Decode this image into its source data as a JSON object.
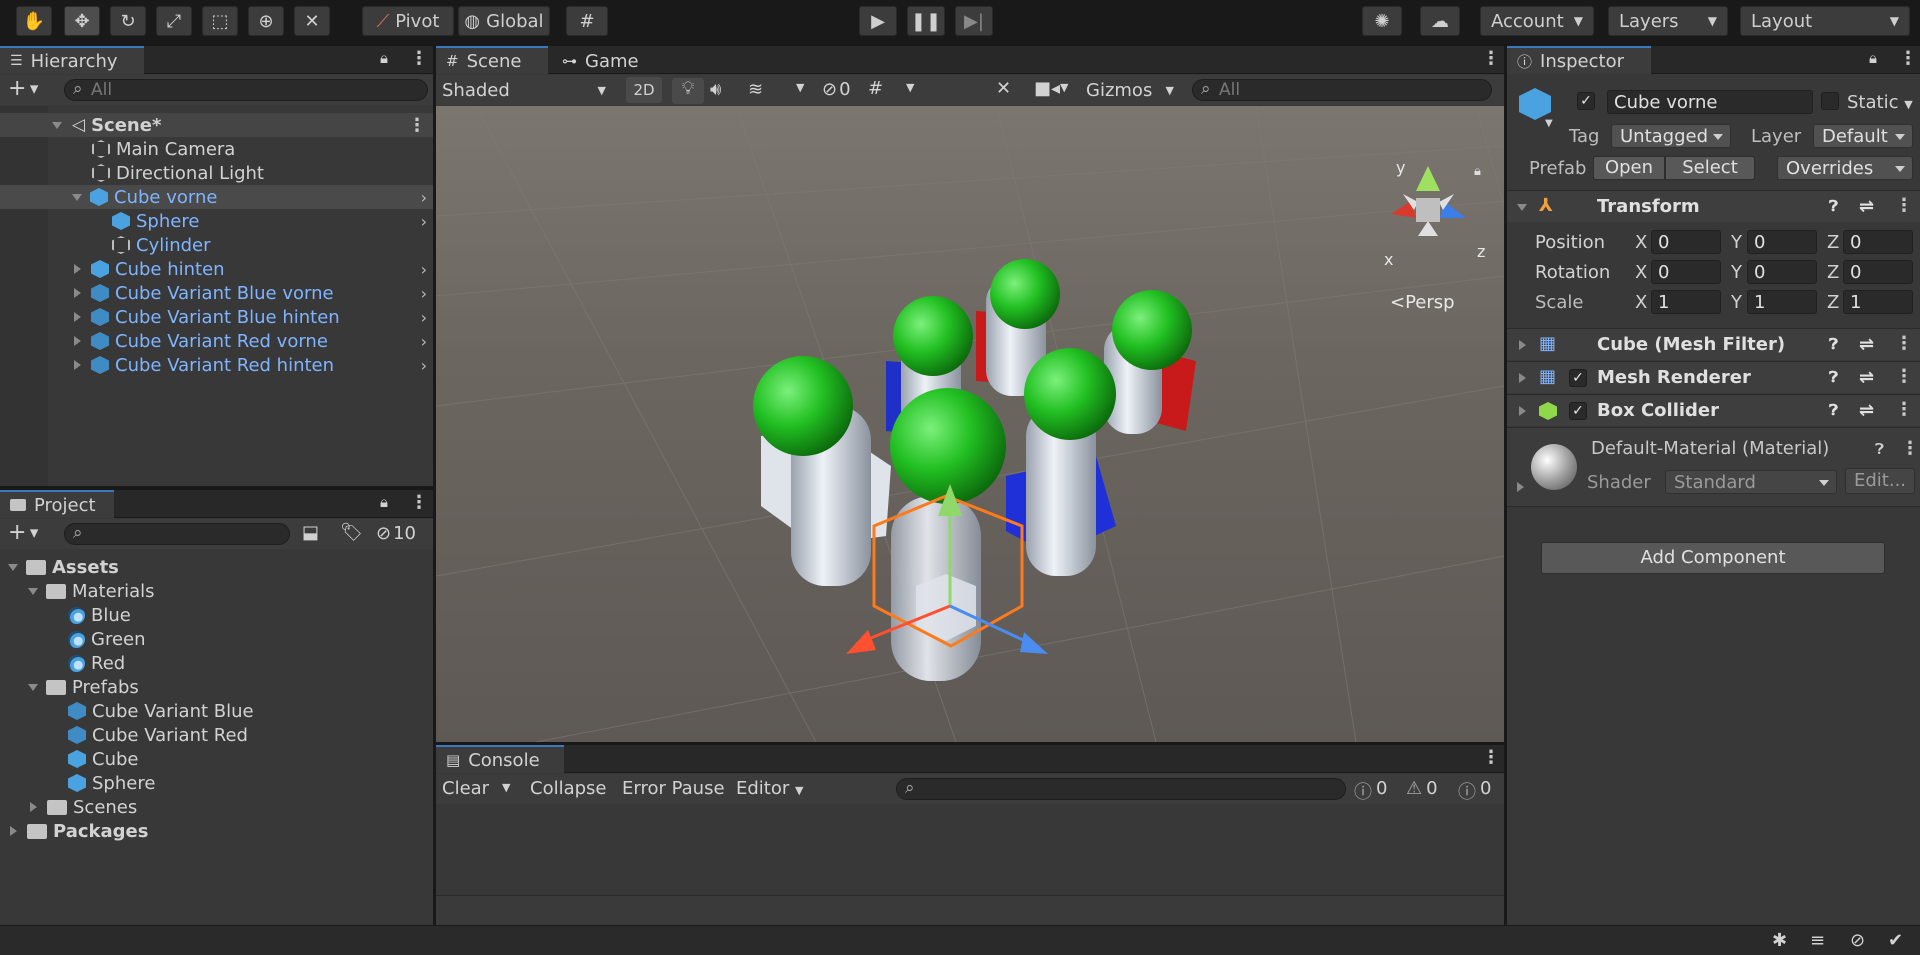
{
  "toolbar": {
    "pivot_label": "Pivot",
    "global_label": "Global",
    "account_label": "Account",
    "layers_label": "Layers",
    "layout_label": "Layout"
  },
  "hierarchy": {
    "tab_label": "Hierarchy",
    "search_placeholder": "All",
    "scene_label": "Scene*",
    "items": [
      {
        "label": "Main Camera"
      },
      {
        "label": "Directional Light"
      },
      {
        "label": "Cube vorne"
      },
      {
        "label": "Sphere"
      },
      {
        "label": "Cylinder"
      },
      {
        "label": "Cube hinten"
      },
      {
        "label": "Cube Variant Blue vorne"
      },
      {
        "label": "Cube Variant Blue hinten"
      },
      {
        "label": "Cube Variant Red vorne"
      },
      {
        "label": "Cube Variant Red hinten"
      }
    ]
  },
  "project": {
    "tab_label": "Project",
    "hidden_count": "10",
    "tree": [
      {
        "label": "Assets"
      },
      {
        "label": "Materials"
      },
      {
        "label": "Blue"
      },
      {
        "label": "Green"
      },
      {
        "label": "Red"
      },
      {
        "label": "Prefabs"
      },
      {
        "label": "Cube Variant Blue"
      },
      {
        "label": "Cube Variant Red"
      },
      {
        "label": "Cube"
      },
      {
        "label": "Sphere"
      },
      {
        "label": "Scenes"
      },
      {
        "label": "Packages"
      }
    ]
  },
  "scene_view": {
    "tab_scene": "Scene",
    "tab_game": "Game",
    "shading_mode": "Shaded",
    "btn_2d": "2D",
    "hidden_count": "0",
    "gizmos_label": "Gizmos",
    "search_placeholder": "All",
    "persp_label": "Persp",
    "axis_x": "x",
    "axis_y": "y",
    "axis_z": "z"
  },
  "console": {
    "tab_label": "Console",
    "clear_label": "Clear",
    "collapse_label": "Collapse",
    "error_pause_label": "Error Pause",
    "editor_label": "Editor",
    "log_count": "0",
    "warn_count": "0",
    "error_count": "0"
  },
  "inspector": {
    "tab_label": "Inspector",
    "object_name": "Cube vorne",
    "static_label": "Static",
    "tag_label": "Tag",
    "tag_value": "Untagged",
    "layer_label": "Layer",
    "layer_value": "Default",
    "prefab_label": "Prefab",
    "open_label": "Open",
    "select_label": "Select",
    "overrides_label": "Overrides",
    "transform_label": "Transform",
    "position_label": "Position",
    "rotation_label": "Rotation",
    "scale_label": "Scale",
    "x": "X",
    "y": "Y",
    "z": "Z",
    "position": [
      "0",
      "0",
      "0"
    ],
    "rotation": [
      "0",
      "0",
      "0"
    ],
    "scale": [
      "1",
      "1",
      "1"
    ],
    "mesh_filter_label": "Cube (Mesh Filter)",
    "mesh_renderer_label": "Mesh Renderer",
    "box_collider_label": "Box Collider",
    "material_label": "Default-Material (Material)",
    "shader_label": "Shader",
    "shader_value": "Standard",
    "edit_label": "Edit...",
    "add_component_label": "Add Component"
  }
}
